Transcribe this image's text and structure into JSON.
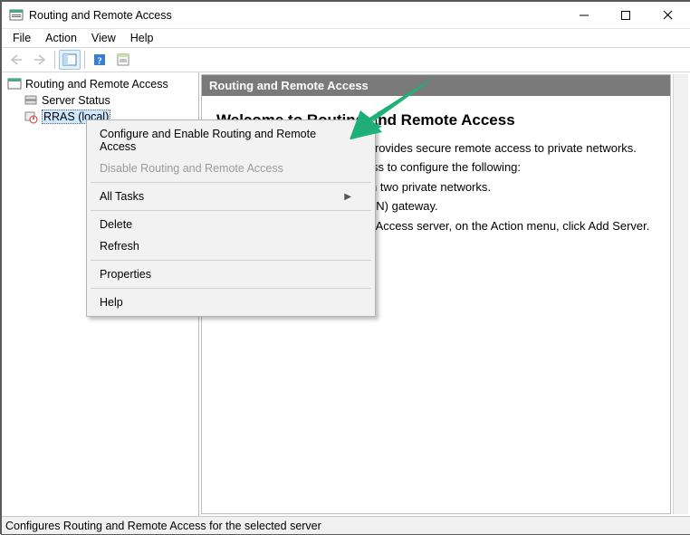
{
  "window": {
    "title": "Routing and Remote Access"
  },
  "menu": {
    "file": "File",
    "action": "Action",
    "view": "View",
    "help": "Help"
  },
  "tree": {
    "root": "Routing and Remote Access",
    "server_status": "Server Status",
    "rras_local": "RRAS (local)"
  },
  "content": {
    "header": "Routing and Remote Access",
    "welcome_title": "Welcome to Routing and Remote Access",
    "intro": "Routing and Remote Access provides secure remote access to private networks.",
    "use_line": "Use Routing and remote access to configure the following:",
    "bullet1": "• A secure connection between two private networks.",
    "bullet2": "• A Virtual Private Network (VPN) gateway.",
    "spacer": " ",
    "add_server_line": "To add a Routing and Remote Access server, on the Action menu, click Add Server."
  },
  "context_menu": {
    "configure": "Configure and Enable Routing and Remote Access",
    "disable": "Disable Routing and Remote Access",
    "all_tasks": "All Tasks",
    "delete": "Delete",
    "refresh": "Refresh",
    "properties": "Properties",
    "help": "Help"
  },
  "status": "Configures Routing and Remote Access for the selected server"
}
